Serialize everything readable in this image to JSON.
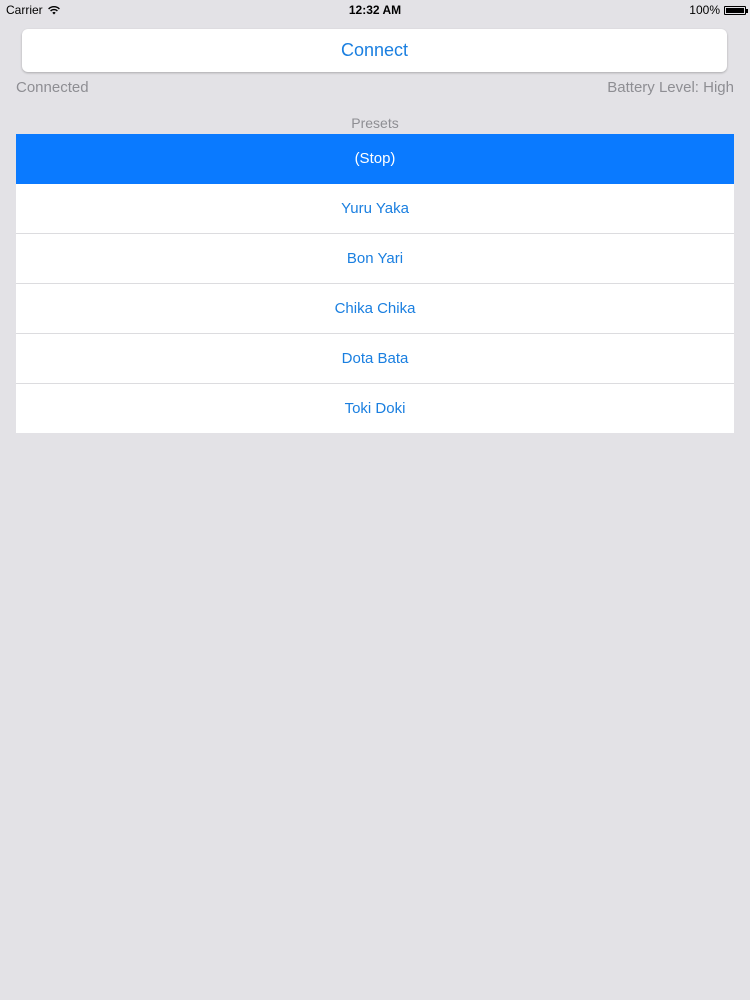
{
  "status_bar": {
    "carrier": "Carrier",
    "time": "12:32 AM",
    "battery_percent": "100%",
    "battery_fill": 1.0,
    "wifi_icon": "wifi-icon",
    "battery_icon": "battery-icon"
  },
  "connect": {
    "label": "Connect"
  },
  "status": {
    "connection": "Connected",
    "battery_level": "Battery Level: High"
  },
  "presets": {
    "header": "Presets",
    "selected_index": 0,
    "items": [
      {
        "label": "(Stop)"
      },
      {
        "label": "Yuru Yaka"
      },
      {
        "label": "Bon Yari"
      },
      {
        "label": "Chika Chika"
      },
      {
        "label": "Dota Bata"
      },
      {
        "label": "Toki Doki"
      }
    ]
  },
  "colors": {
    "background": "#e3e2e6",
    "accent": "#1a7fe0",
    "selected": "#0a7aff",
    "secondary_text": "#8e8e93"
  }
}
